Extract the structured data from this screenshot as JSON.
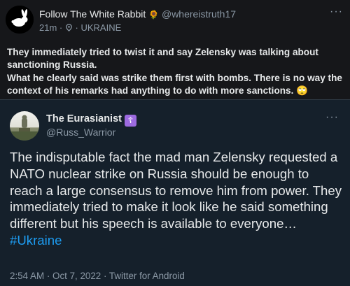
{
  "post": {
    "display_name": "Follow The White Rabbit",
    "name_emoji": "🌻",
    "handle": "@whereistruth17",
    "time": "21m",
    "location": "UKRAINE",
    "separator": "·",
    "more": "···",
    "body_line1": "They immediately tried to twist it and say Zelensky was talking about sanctioning Russia.",
    "body_line2": "What he clearly said was strike them first with bombs. There is no way the context of his remarks had anything to do with more sanctions.",
    "body_emoji": "🙄"
  },
  "quote": {
    "display_name": "The Eurasianist",
    "badge": "☦",
    "handle": "@Russ_Warrior",
    "more": "···",
    "text": "The indisputable fact the mad man Zelensky requested a NATO nuclear strike on Russia should be enough to reach a large consensus to remove him from power. They immediately tried to make it look like he said something different but his speech is available to everyone…",
    "hashtag": "#Ukraine",
    "timestamp": "2:54 AM · Oct 7, 2022 · ",
    "client": "Twitter for Android"
  },
  "colors": {
    "background": "#15202b",
    "top_background": "#16171a",
    "text": "#e7e9ea",
    "secondary": "#8b98a5",
    "link": "#1d9bf0",
    "badge": "#9c6adf"
  },
  "icons": {
    "avatar_top": "rabbit-avatar",
    "location": "location-pin-icon",
    "badge": "orthodox-cross-icon"
  }
}
